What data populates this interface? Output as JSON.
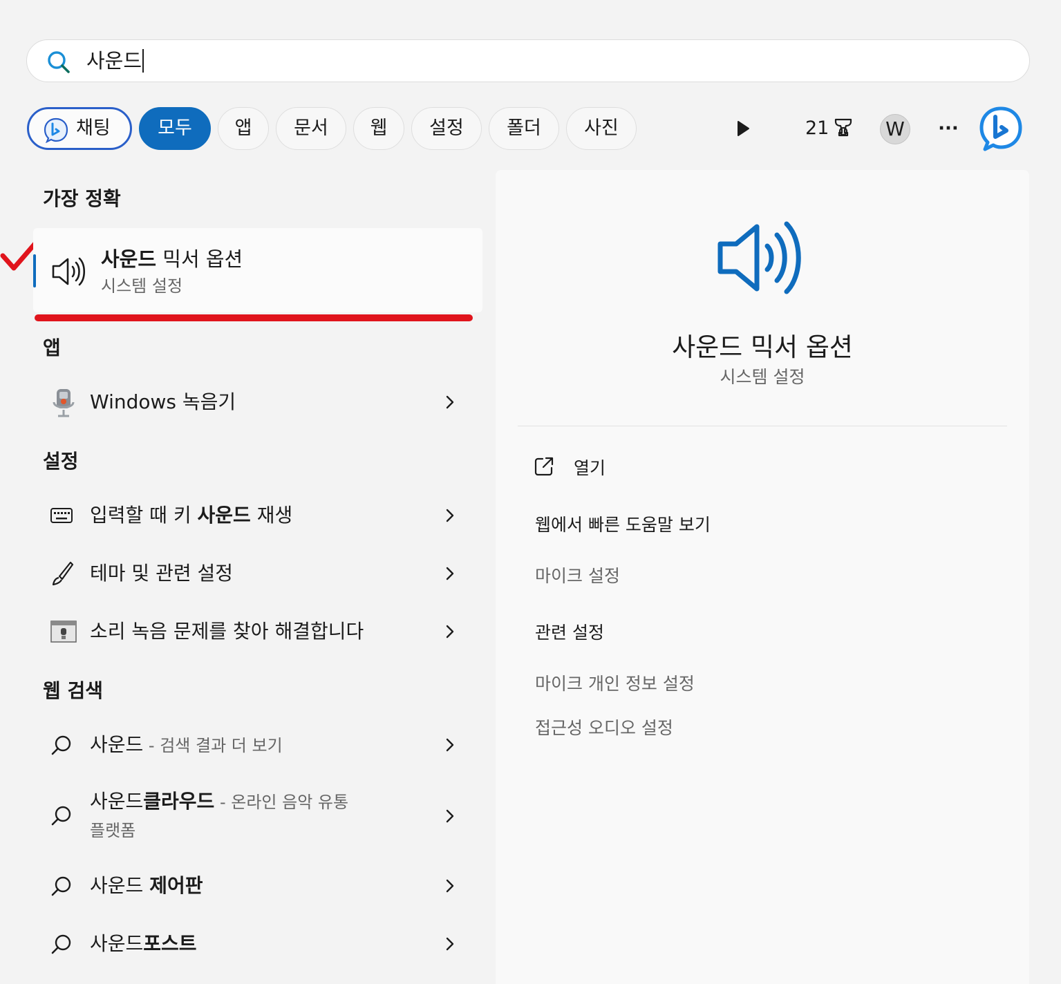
{
  "search": {
    "query": "사운드"
  },
  "filters": {
    "chat": "채팅",
    "all": "모두",
    "apps": "앱",
    "documents": "문서",
    "web": "웹",
    "settings": "설정",
    "folders": "폴더",
    "photos": "사진"
  },
  "toolbar": {
    "points": "21",
    "avatar_letter": "W",
    "more": "···"
  },
  "best_match": {
    "heading": "가장 정확",
    "title_bold": "사운드",
    "title_rest": " 믹서 옵션",
    "subtitle": "시스템 설정"
  },
  "apps": {
    "heading": "앱",
    "items": [
      {
        "label": "Windows 녹음기"
      }
    ]
  },
  "settings": {
    "heading": "설정",
    "items": [
      {
        "pre": "입력할 때 키 ",
        "bold": "사운드",
        "post": " 재생"
      },
      {
        "label": "테마 및 관련 설정"
      },
      {
        "label": "소리 녹음 문제를 찾아 해결합니다"
      }
    ]
  },
  "web_search": {
    "heading": "웹 검색",
    "items": [
      {
        "query": "사운드",
        "bold": "",
        "suffix": " - 검색 결과 더 보기",
        "line2": ""
      },
      {
        "query": "사운드",
        "bold": "클라우드",
        "suffix": " - 온라인 음악 유통",
        "line2": "플랫폼"
      },
      {
        "query": "사운드 ",
        "bold": "제어판",
        "suffix": "",
        "line2": ""
      },
      {
        "query": "사운드",
        "bold": "포스트",
        "suffix": "",
        "line2": ""
      }
    ]
  },
  "preview": {
    "title": "사운드 믹서 옵션",
    "subtitle": "시스템 설정",
    "open": "열기",
    "web_help": "웹에서 빠른 도움말 보기",
    "mic_settings": "마이크 설정",
    "related_heading": "관련 설정",
    "mic_privacy": "마이크 개인 정보 설정",
    "accessibility_audio": "접근성 오디오 설정"
  },
  "colors": {
    "accent": "#0f6cbd",
    "annotation": "#e0141c",
    "bing": "#1e88e5"
  }
}
